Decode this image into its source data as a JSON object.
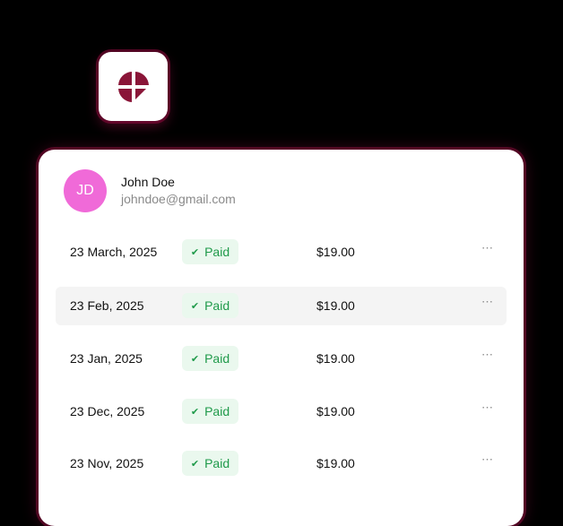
{
  "user": {
    "initials": "JD",
    "name": "John Doe",
    "email": "johndoe@gmail.com"
  },
  "payments": [
    {
      "date": "23 March, 2025",
      "status": "Paid",
      "amount": "$19.00"
    },
    {
      "date": "23 Feb, 2025",
      "status": "Paid",
      "amount": "$19.00"
    },
    {
      "date": "23 Jan, 2025",
      "status": "Paid",
      "amount": "$19.00"
    },
    {
      "date": "23 Dec, 2025",
      "status": "Paid",
      "amount": "$19.00"
    },
    {
      "date": "23 Nov, 2025",
      "status": "Paid",
      "amount": "$19.00"
    }
  ],
  "icons": {
    "check": "✔",
    "more": "⋯"
  },
  "colors": {
    "brand": "#8a1538",
    "avatar": "#f06ad8",
    "paid": "#1f9a4a"
  }
}
